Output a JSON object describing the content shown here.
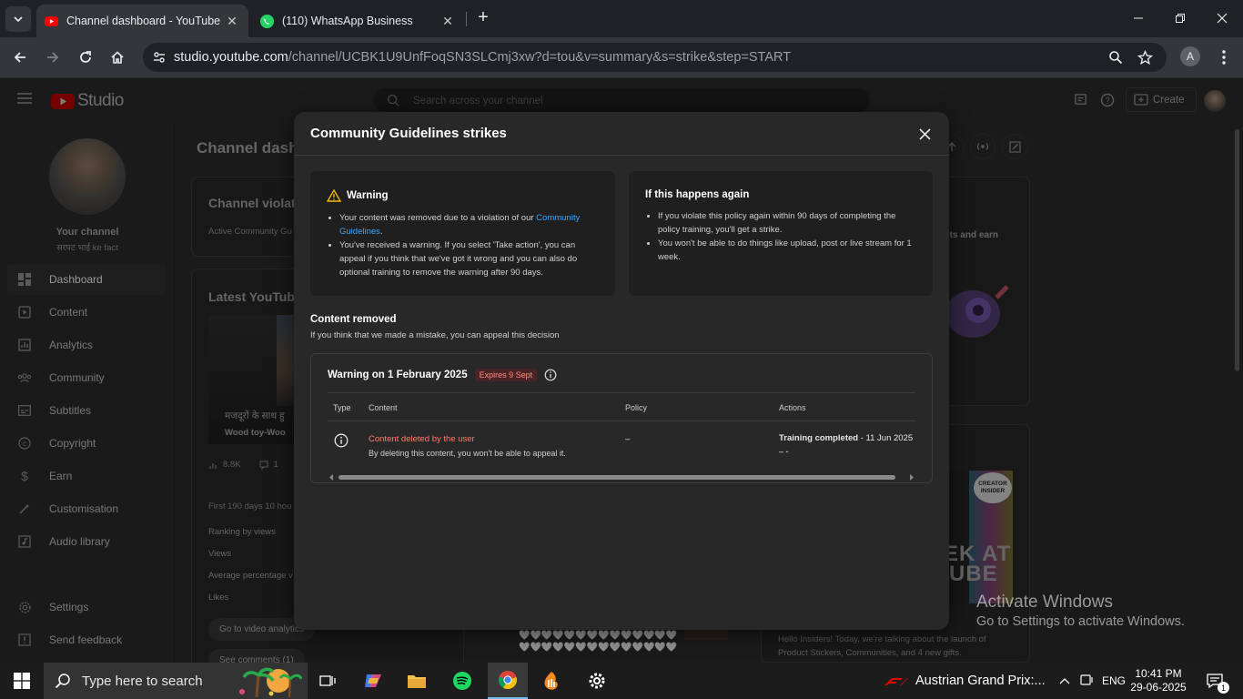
{
  "browser": {
    "tabs": [
      {
        "title": "Channel dashboard - YouTube S",
        "active": true
      },
      {
        "title": "(110) WhatsApp Business",
        "active": false
      }
    ],
    "url_host": "studio.youtube.com",
    "url_path": "/channel/UCBK1U9UnfFoqSN3SLCmj3xw?d=tou&v=summary&s=strike&step=START",
    "profile_initial": "A"
  },
  "studio": {
    "logo_text": "Studio",
    "search_placeholder": "Search across your channel",
    "create_label": "Create",
    "page_title": "Channel dash",
    "channel": {
      "label": "Your channel",
      "name": "सरपट भाई ke fact"
    },
    "nav": [
      {
        "label": "Dashboard",
        "icon": "dashboard-icon",
        "active": true
      },
      {
        "label": "Content",
        "icon": "content-icon"
      },
      {
        "label": "Analytics",
        "icon": "analytics-icon"
      },
      {
        "label": "Community",
        "icon": "community-icon"
      },
      {
        "label": "Subtitles",
        "icon": "subtitles-icon"
      },
      {
        "label": "Copyright",
        "icon": "copyright-icon"
      },
      {
        "label": "Earn",
        "icon": "earn-icon"
      },
      {
        "label": "Customisation",
        "icon": "customisation-icon"
      },
      {
        "label": "Audio library",
        "icon": "audio-library-icon"
      }
    ],
    "nav_bottom": [
      {
        "label": "Settings",
        "icon": "settings-icon"
      },
      {
        "label": "Send feedback",
        "icon": "feedback-icon"
      }
    ],
    "violations_card": {
      "title": "Channel violati",
      "sub": "Active Community Gu"
    },
    "latest_card": {
      "title": "Latest YouTube",
      "video_caption": "मजदूरों के साथ हु",
      "video_sub": "Wood toy-Woo",
      "views": "8.8K",
      "comments": "1",
      "period": "First 190 days 10 hou",
      "rows": [
        "Ranking by views",
        "Views",
        "Average percentage v",
        "Likes"
      ],
      "btn_analytics": "Go to video analytics",
      "btn_comments": "See comments (1)"
    },
    "right_card": {
      "text": "ts and earn"
    },
    "insider": {
      "badge": "CREATOR INSIDER",
      "big_text_1": "EK AT",
      "big_text_2": "UBE",
      "desc_1": "Hello Insiders! Today, we're talking about the launch of",
      "desc_2": "Product Stickers, Communities, and 4 new gifts."
    },
    "hearts": "🤍🤍🤍🤍🤍🤍🤍🤍🤍🤍🤍🤍🤍🤍🤍🤍🤍🤍🤍🤍🤍🤍🤍🤍🤍🤍🤍🤍🤍🤍🤍🤍🤍🤍"
  },
  "modal": {
    "title": "Community Guidelines strikes",
    "warning_box": {
      "title": "Warning",
      "bullet1_pre": "Your content was removed due to a violation of our ",
      "bullet1_link": "Community Guidelines",
      "bullet1_post": ".",
      "bullet2": "You've received a warning. If you select 'Take action', you can appeal if you think that we've got it wrong and you can also do optional training to remove the warning after 90 days."
    },
    "again_box": {
      "title": "If this happens again",
      "bullet1": "If you violate this policy again within 90 days of completing the policy training, you'll get a strike.",
      "bullet2": "You won't be able to do things like upload, post or live stream for 1 week."
    },
    "content_removed_title": "Content removed",
    "content_removed_sub": "If you think that we made a mistake, you can appeal this decision",
    "warning_card": {
      "title": "Warning on 1 February 2025",
      "expires": "Expires 9 Sept",
      "columns": [
        "Type",
        "Content",
        "Policy",
        "Actions"
      ],
      "row": {
        "content_title": "Content deleted by the user",
        "content_sub": "By deleting this content, you won't be able to appeal it.",
        "policy": "–",
        "action_bold": "Training completed",
        "action_date": " - 11 Jun 2025 (",
        "action_line2": "– -"
      }
    }
  },
  "watermark": {
    "line1": "Activate Windows",
    "line2": "Go to Settings to activate Windows."
  },
  "taskbar": {
    "search_placeholder": "Type here to search",
    "news": "Austrian Grand Prix:...",
    "lang": "ENG",
    "time": "10:41 PM",
    "date": "29-06-2025",
    "notif_count": "1"
  },
  "colors": {
    "accent_link": "#3ea6ff",
    "youtube_red": "#ff0000",
    "warning_red": "#ff8a80"
  }
}
